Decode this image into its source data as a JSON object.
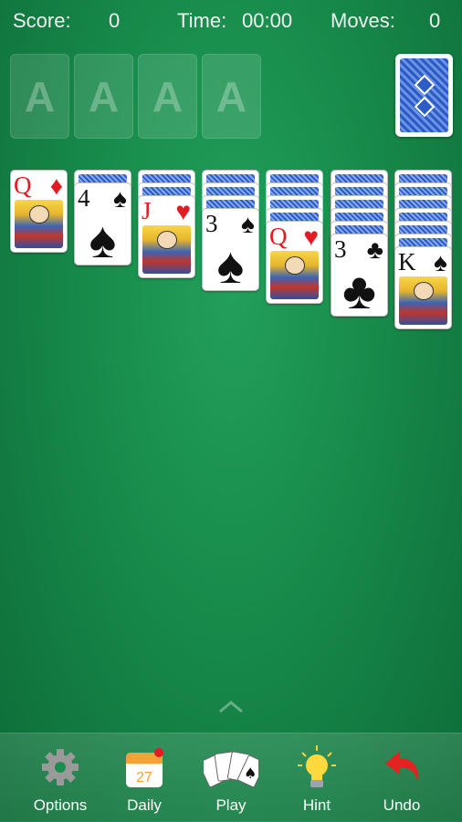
{
  "header": {
    "score_label": "Score:",
    "score_value": "0",
    "time_label": "Time:",
    "time_value": "00:00",
    "moves_label": "Moves:",
    "moves_value": "0"
  },
  "foundations": [
    "A",
    "A",
    "A",
    "A"
  ],
  "tableau": [
    {
      "face_down": 0,
      "rank": "Q",
      "suit": "♦",
      "color": "red"
    },
    {
      "face_down": 1,
      "rank": "4",
      "suit": "♠",
      "color": "black"
    },
    {
      "face_down": 2,
      "rank": "J",
      "suit": "♥",
      "color": "red"
    },
    {
      "face_down": 3,
      "rank": "3",
      "suit": "♠",
      "color": "black"
    },
    {
      "face_down": 4,
      "rank": "Q",
      "suit": "♥",
      "color": "red"
    },
    {
      "face_down": 5,
      "rank": "3",
      "suit": "♣",
      "color": "black"
    },
    {
      "face_down": 6,
      "rank": "K",
      "suit": "♠",
      "color": "black"
    }
  ],
  "toolbar": {
    "options_label": "Options",
    "daily_label": "Daily",
    "daily_date": "27",
    "play_label": "Play",
    "hint_label": "Hint",
    "undo_label": "Undo"
  },
  "icons": {
    "options": "gear-icon",
    "daily": "calendar-icon",
    "play": "cards-fan-icon",
    "hint": "lightbulb-icon",
    "undo": "undo-arrow-icon",
    "expand": "chevron-up-icon"
  },
  "colors": {
    "felt": "#178a4a",
    "red_suit": "#e31b23",
    "card_back": "#2d5cc7"
  }
}
